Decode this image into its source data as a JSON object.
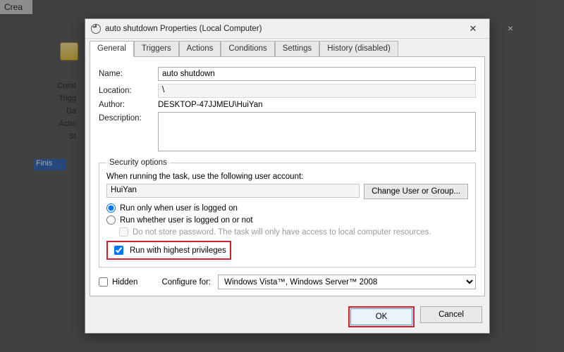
{
  "background": {
    "parent_title_fragment": "Crea",
    "close_x": "×",
    "labels": [
      "Creat",
      "Trigg",
      "Da",
      "Actio",
      "St"
    ],
    "finish_label": "Finis"
  },
  "dialog": {
    "title": "auto shutdown Properties (Local Computer)",
    "close_tooltip": "Close"
  },
  "tabs": [
    "General",
    "Triggers",
    "Actions",
    "Conditions",
    "Settings",
    "History (disabled)"
  ],
  "general": {
    "name_label": "Name:",
    "name_value": "auto shutdown",
    "location_label": "Location:",
    "location_value": "\\",
    "author_label": "Author:",
    "author_value": "DESKTOP-47JJMEU\\HuiYan",
    "description_label": "Description:",
    "description_value": ""
  },
  "security": {
    "legend": "Security options",
    "prompt": "When running the task, use the following user account:",
    "account": "HuiYan",
    "change_btn": "Change User or Group...",
    "radio_logged_on": "Run only when user is logged on",
    "radio_whether": "Run whether user is logged on or not",
    "dont_store": "Do not store password.  The task will only have access to local computer resources.",
    "highest_priv": "Run with highest privileges",
    "radio_selected": "logged_on",
    "highest_priv_checked": true,
    "dont_store_checked": false
  },
  "footer": {
    "hidden_label": "Hidden",
    "hidden_checked": false,
    "configure_label": "Configure for:",
    "configure_value": "Windows Vista™, Windows Server™ 2008"
  },
  "buttons": {
    "ok": "OK",
    "cancel": "Cancel"
  }
}
